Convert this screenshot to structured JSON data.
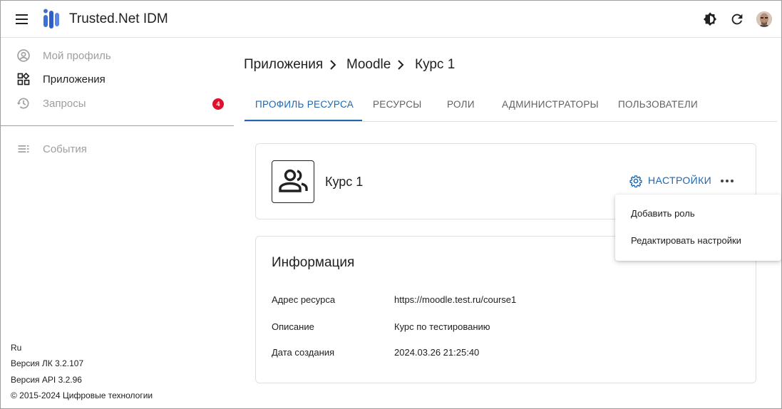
{
  "header": {
    "app_title": "Trusted.Net IDM",
    "icons": [
      "menu-icon",
      "app-logo",
      "theme-toggle-icon",
      "refresh-icon",
      "user-avatar"
    ]
  },
  "sidebar": {
    "items": [
      {
        "label": "Мой профиль",
        "icon": "account-circle-icon",
        "state": "muted"
      },
      {
        "label": "Приложения",
        "icon": "apps-grid-icon",
        "state": "active"
      },
      {
        "label": "Запросы",
        "icon": "history-icon",
        "state": "muted",
        "badge": "4"
      },
      {
        "label": "События",
        "icon": "events-list-icon",
        "state": "muted"
      }
    ],
    "footer": {
      "language": "Ru",
      "lk_version": "Версия ЛК 3.2.107",
      "api_version": "Версия API 3.2.96",
      "copyright": "© 2015-2024 Цифровые технологии"
    }
  },
  "breadcrumb": [
    "Приложения",
    "Moodle",
    "Курс 1"
  ],
  "tabs": [
    {
      "label": "ПРОФИЛЬ РЕСУРСА",
      "active": true
    },
    {
      "label": "РЕСУРСЫ",
      "active": false
    },
    {
      "label": "РОЛИ",
      "active": false
    },
    {
      "label": "АДМИНИСТРАТОРЫ",
      "active": false
    },
    {
      "label": "ПОЛЬЗОВАТЕЛИ",
      "active": false
    }
  ],
  "resource": {
    "name": "Курс 1",
    "icon": "group-icon",
    "settings_label": "НАСТРОЙКИ"
  },
  "dropdown": {
    "items": [
      "Добавить роль",
      "Редактировать настройки"
    ]
  },
  "info": {
    "title": "Информация",
    "rows": [
      {
        "key": "Адрес ресурса",
        "value": "https://moodle.test.ru/course1"
      },
      {
        "key": "Описание",
        "value": "Курс по тестированию"
      },
      {
        "key": "Дата создания",
        "value": "2024.03.26 21:25:40"
      }
    ]
  },
  "colors": {
    "accent": "#1e66b0",
    "badge": "#e0102f",
    "muted_text": "#9e9e9e",
    "logo": "#3f6fd8"
  }
}
